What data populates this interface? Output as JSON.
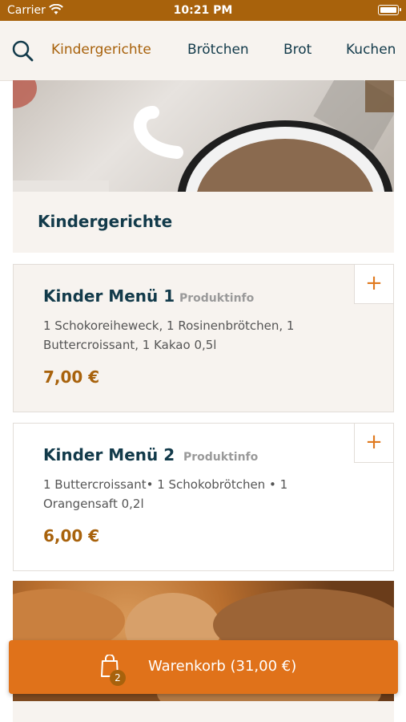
{
  "status": {
    "carrier": "Carrier",
    "time": "10:21 PM"
  },
  "nav": {
    "tabs": [
      {
        "label": "Kindergerichte",
        "active": true
      },
      {
        "label": "Brötchen",
        "active": false
      },
      {
        "label": "Brot",
        "active": false
      },
      {
        "label": "Kuchen",
        "active": false
      }
    ]
  },
  "section": {
    "title": "Kindergerichte"
  },
  "products": [
    {
      "name": "Kinder Menü 1",
      "info_label": "Produktinfo",
      "description": "1 Schokoreiheweck, 1 Rosinenbrötchen, 1 Buttercroissant, 1 Kakao 0,5l",
      "price": "7,00 €"
    },
    {
      "name": "Kinder Menü 2",
      "info_label": "Produktinfo",
      "description": "1 Buttercroissant• 1 Schokobrötchen • 1 Orangensaft 0,2l",
      "price": "6,00 €"
    }
  ],
  "cart": {
    "label": "Warenkorb (31,00 €)",
    "count": "2"
  },
  "colors": {
    "brand": "#a8620c",
    "accent": "#e0721a",
    "text": "#123a4a",
    "background": "#f7f3ef"
  }
}
